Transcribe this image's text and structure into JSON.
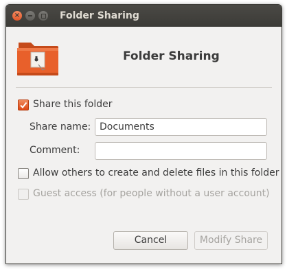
{
  "window": {
    "title": "Folder Sharing",
    "controls": {
      "close": "×"
    }
  },
  "header": {
    "title": "Folder Sharing"
  },
  "form": {
    "share_checkbox": {
      "label": "Share this folder",
      "checked": true
    },
    "share_name": {
      "label": "Share name:",
      "value": "Documents"
    },
    "comment": {
      "label": "Comment:",
      "value": ""
    },
    "allow_others": {
      "label": "Allow others to create and delete files in this folder",
      "checked": false
    },
    "guest_access": {
      "label": "Guest access (for people without a user account)",
      "checked": false,
      "disabled": true
    }
  },
  "buttons": {
    "cancel": "Cancel",
    "modify_share": "Modify Share"
  },
  "colors": {
    "accent": "#dd4814",
    "titlebar": "#3c3b37",
    "window_bg": "#f2f1f0"
  },
  "icons": {
    "header_icon": "folder-share-icon"
  }
}
